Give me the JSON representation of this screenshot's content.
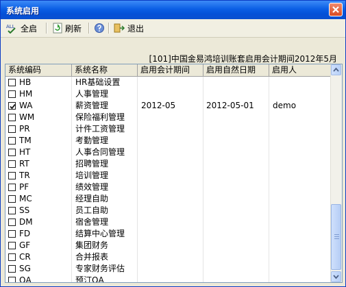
{
  "window": {
    "title": "系统启用"
  },
  "toolbar": {
    "select_all": "全启",
    "refresh": "刷新",
    "exit": "退出",
    "all_icon_text": "ALL"
  },
  "info": {
    "period": "[101]中国金易鸿培训账套启用会计期间2012年5月"
  },
  "grid": {
    "columns": [
      "系统编码",
      "系统名称",
      "启用会计期间",
      "启用自然日期",
      "启用人"
    ],
    "rows": [
      {
        "checked": false,
        "code": "HB",
        "name": "HR基础设置",
        "period": "",
        "date": "",
        "user": ""
      },
      {
        "checked": false,
        "code": "HM",
        "name": "人事管理",
        "period": "",
        "date": "",
        "user": ""
      },
      {
        "checked": true,
        "code": "WA",
        "name": "薪资管理",
        "period": "2012-05",
        "date": "2012-05-01",
        "user": "demo"
      },
      {
        "checked": false,
        "code": "WM",
        "name": "保险福利管理",
        "period": "",
        "date": "",
        "user": ""
      },
      {
        "checked": false,
        "code": "PR",
        "name": "计件工资管理",
        "period": "",
        "date": "",
        "user": ""
      },
      {
        "checked": false,
        "code": "TM",
        "name": "考勤管理",
        "period": "",
        "date": "",
        "user": ""
      },
      {
        "checked": false,
        "code": "HT",
        "name": "人事合同管理",
        "period": "",
        "date": "",
        "user": ""
      },
      {
        "checked": false,
        "code": "RT",
        "name": "招聘管理",
        "period": "",
        "date": "",
        "user": ""
      },
      {
        "checked": false,
        "code": "TR",
        "name": "培训管理",
        "period": "",
        "date": "",
        "user": ""
      },
      {
        "checked": false,
        "code": "PF",
        "name": "绩效管理",
        "period": "",
        "date": "",
        "user": ""
      },
      {
        "checked": false,
        "code": "MC",
        "name": "经理自助",
        "period": "",
        "date": "",
        "user": ""
      },
      {
        "checked": false,
        "code": "SS",
        "name": "员工自助",
        "period": "",
        "date": "",
        "user": ""
      },
      {
        "checked": false,
        "code": "DM",
        "name": "宿舍管理",
        "period": "",
        "date": "",
        "user": ""
      },
      {
        "checked": false,
        "code": "FD",
        "name": "结算中心管理",
        "period": "",
        "date": "",
        "user": ""
      },
      {
        "checked": false,
        "code": "GF",
        "name": "集团财务",
        "period": "",
        "date": "",
        "user": ""
      },
      {
        "checked": false,
        "code": "CR",
        "name": "合并报表",
        "period": "",
        "date": "",
        "user": ""
      },
      {
        "checked": false,
        "code": "SG",
        "name": "专家财务评估",
        "period": "",
        "date": "",
        "user": ""
      },
      {
        "checked": false,
        "code": "QA",
        "name": "预汀QA",
        "period": "",
        "date": "",
        "user": ""
      }
    ]
  }
}
